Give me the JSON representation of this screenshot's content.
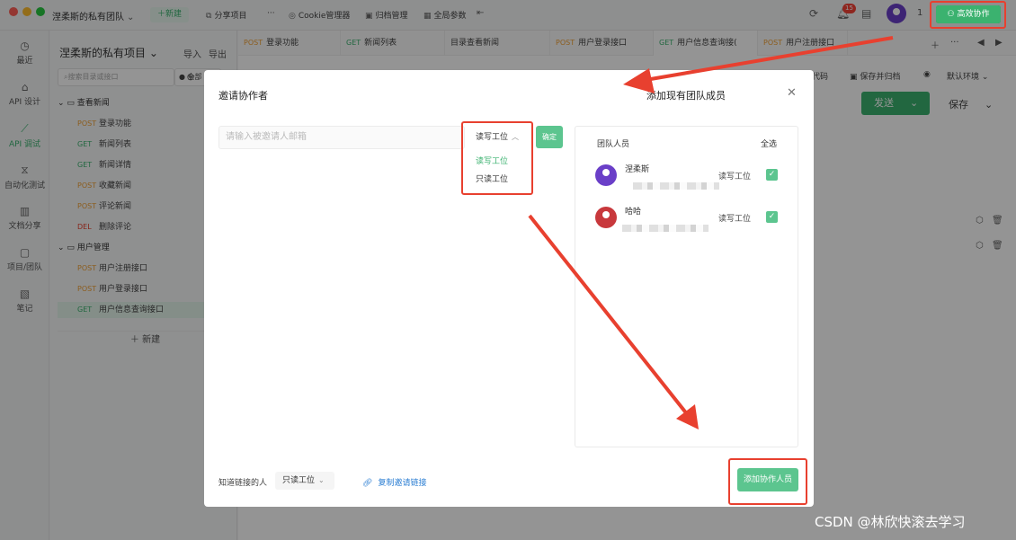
{
  "topbar": {
    "team_name": "涅柔斯的私有团队",
    "new_label": "＋新建",
    "share_label": "分享项目",
    "more_label": "···",
    "cookie_label": "Cookie管理器",
    "archive_label": "归档管理",
    "global_label": "全局参数",
    "notify_count": "15",
    "user_count": "1",
    "collab_label": "高效协作"
  },
  "rail": [
    {
      "label": "最近",
      "icon": "clock-icon"
    },
    {
      "label": "API 设计",
      "icon": "api-icon"
    },
    {
      "label": "API 调试",
      "icon": "debug-icon"
    },
    {
      "label": "自动化测试",
      "icon": "test-icon"
    },
    {
      "label": "文档分享",
      "icon": "doc-icon"
    },
    {
      "label": "项目/团队",
      "icon": "team-icon"
    },
    {
      "label": "笔记",
      "icon": "note-icon"
    }
  ],
  "tree": {
    "project_title": "涅柔斯的私有项目",
    "import_label": "导入",
    "export_label": "导出",
    "search_placeholder": "搜索目录或接口",
    "filter_label": "全部",
    "folders": [
      {
        "name": "查看新闻"
      },
      {
        "name": "用户管理"
      }
    ],
    "items": [
      {
        "method": "POST",
        "name": "登录功能"
      },
      {
        "method": "GET",
        "name": "新闻列表"
      },
      {
        "method": "GET",
        "name": "新闻详情"
      },
      {
        "method": "POST",
        "name": "收藏新闻"
      },
      {
        "method": "POST",
        "name": "评论新闻"
      },
      {
        "method": "DEL",
        "name": "删除评论"
      },
      {
        "method": "POST",
        "name": "用户注册接口"
      },
      {
        "method": "POST",
        "name": "用户登录接口"
      },
      {
        "method": "GET",
        "name": "用户信息查询接口"
      }
    ],
    "new_label": "＋ 新建"
  },
  "tabs": [
    {
      "method": "POST",
      "name": "登录功能"
    },
    {
      "method": "GET",
      "name": "新闻列表"
    },
    {
      "method": "",
      "name": "目录查看新闻"
    },
    {
      "method": "POST",
      "name": "用户登录接口"
    },
    {
      "method": "GET",
      "name": "用户信息查询接("
    },
    {
      "method": "POST",
      "name": "用户注册接口"
    }
  ],
  "main": {
    "gen_code_label": "代码",
    "save_archive_label": "保存并归档",
    "env_label": "默认环境",
    "send_label": "发送",
    "save_label": "保存"
  },
  "modal": {
    "title": "邀请协作者",
    "right_title": "添加现有团队成员",
    "email_placeholder": "请输入被邀请人邮箱",
    "perm_selected": "读写工位",
    "perm_options": [
      "读写工位",
      "只读工位"
    ],
    "confirm_label": "确定",
    "team_header": "团队人员",
    "select_all": "全选",
    "members": [
      {
        "name": "涅柔斯",
        "perm": "读写工位",
        "avatar_color": "#6a3fc8"
      },
      {
        "name": "哈哈",
        "perm": "读写工位",
        "avatar_color": "#c8383c"
      }
    ],
    "link_label": "知道链接的人",
    "link_perm": "只读工位",
    "copy_link_label": "复制邀请链接",
    "add_label": "添加协作人员"
  },
  "watermark": "CSDN @林欣快滚去学习",
  "colors": {
    "accent": "#3bb26f",
    "annotation": "#e8402f"
  }
}
